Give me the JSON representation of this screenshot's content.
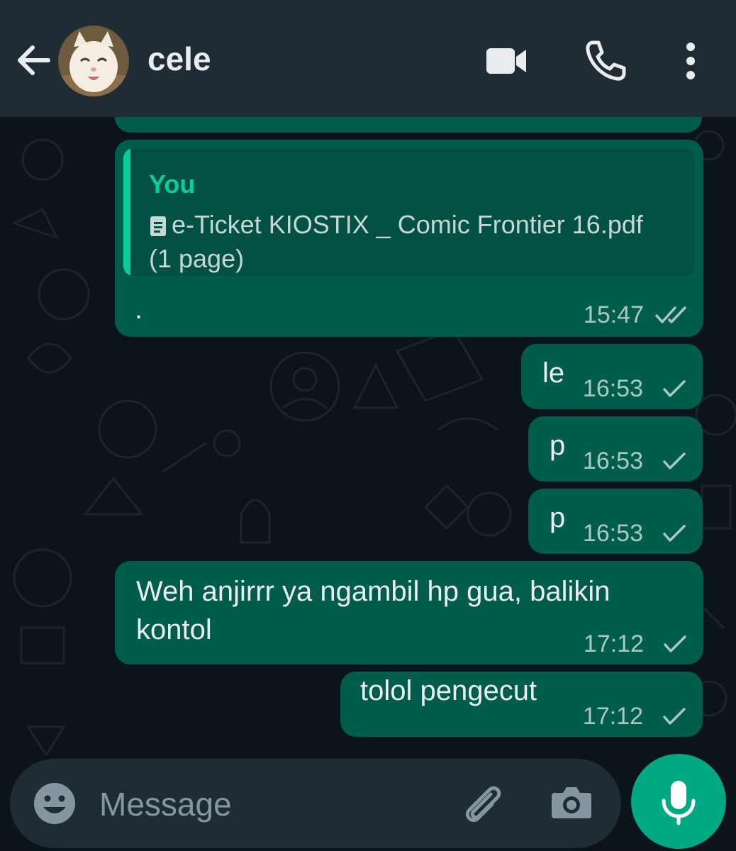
{
  "header": {
    "contact_name": "cele"
  },
  "messages": [
    {
      "quote_author": "You",
      "quote_text": "e-Ticket KIOSTIX _ Comic Frontier 16.pdf (1 page)",
      "text": ".",
      "time": "15:47",
      "status": "read"
    },
    {
      "text": "le",
      "time": "16:53",
      "status": "sent"
    },
    {
      "text": "p",
      "time": "16:53",
      "status": "sent"
    },
    {
      "text": "p",
      "time": "16:53",
      "status": "sent"
    },
    {
      "text": "Weh anjirrr ya ngambil hp gua, balikin\nkontol",
      "time": "17:12",
      "status": "sent"
    },
    {
      "text": "tolol pengecut",
      "time": "17:12",
      "status": "sent"
    }
  ],
  "input": {
    "placeholder": "Message"
  },
  "icons": {
    "back": "arrow-back-icon",
    "video": "video-camera-icon",
    "call": "phone-icon",
    "menu": "more-vertical-icon",
    "emoji": "emoji-icon",
    "attach": "paperclip-icon",
    "camera": "camera-icon",
    "mic": "microphone-icon",
    "document": "document-icon",
    "read": "double-check-icon",
    "sent": "single-check-icon"
  },
  "colors": {
    "header_bg": "#1f2c34",
    "chat_bg": "#0b141a",
    "outgoing_bubble": "#005c4b",
    "accent": "#00a884"
  }
}
